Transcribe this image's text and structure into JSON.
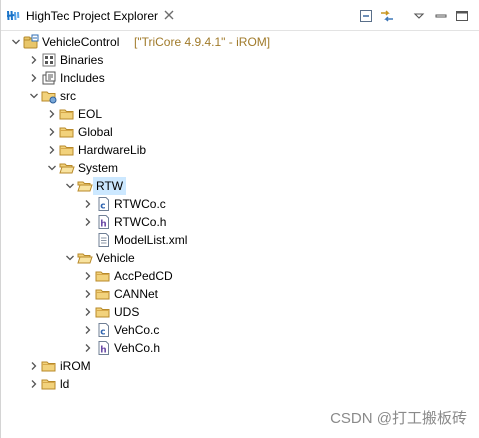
{
  "view": {
    "title": "HighTec Project Explorer",
    "icons": [
      "hightec-logo-icon",
      "close-icon",
      "collapse-all-icon",
      "link-with-editor-icon",
      "view-menu-icon",
      "minimize-icon",
      "maximize-icon"
    ]
  },
  "tree": [
    {
      "label": "VehicleControl",
      "decoration": " [\"TriCore 4.9.4.1\" - iROM]",
      "icon": "project-icon",
      "expanded": true,
      "depth": 0
    },
    {
      "label": "Binaries",
      "icon": "binaries-icon",
      "expanded": false,
      "depth": 1
    },
    {
      "label": "Includes",
      "icon": "includes-icon",
      "expanded": false,
      "depth": 1
    },
    {
      "label": "src",
      "icon": "source-folder-icon",
      "expanded": true,
      "depth": 1
    },
    {
      "label": "EOL",
      "icon": "folder-icon",
      "expanded": false,
      "depth": 2
    },
    {
      "label": "Global",
      "icon": "folder-icon",
      "expanded": false,
      "depth": 2
    },
    {
      "label": "HardwareLib",
      "icon": "folder-icon",
      "expanded": false,
      "depth": 2
    },
    {
      "label": "System",
      "icon": "folder-open-icon",
      "expanded": true,
      "depth": 2
    },
    {
      "label": "RTW",
      "icon": "folder-open-icon",
      "expanded": true,
      "depth": 3,
      "selected": true
    },
    {
      "label": "RTWCo.c",
      "icon": "c-file-icon",
      "expanded": false,
      "depth": 4
    },
    {
      "label": "RTWCo.h",
      "icon": "h-file-icon",
      "expanded": false,
      "depth": 4
    },
    {
      "label": "ModelList.xml",
      "icon": "xml-file-icon",
      "leaf": true,
      "depth": 4
    },
    {
      "label": "Vehicle",
      "icon": "folder-open-icon",
      "expanded": true,
      "depth": 3
    },
    {
      "label": "AccPedCD",
      "icon": "folder-icon",
      "expanded": false,
      "depth": 4
    },
    {
      "label": "CANNet",
      "icon": "folder-icon",
      "expanded": false,
      "depth": 4
    },
    {
      "label": "UDS",
      "icon": "folder-icon",
      "expanded": false,
      "depth": 4
    },
    {
      "label": "VehCo.c",
      "icon": "c-file-icon",
      "expanded": false,
      "depth": 4
    },
    {
      "label": "VehCo.h",
      "icon": "h-file-icon",
      "expanded": false,
      "depth": 4
    },
    {
      "label": "iROM",
      "icon": "folder-icon",
      "expanded": false,
      "depth": 1
    },
    {
      "label": "ld",
      "icon": "folder-icon",
      "expanded": false,
      "depth": 1
    }
  ],
  "watermark": "CSDN @打工搬板砖"
}
